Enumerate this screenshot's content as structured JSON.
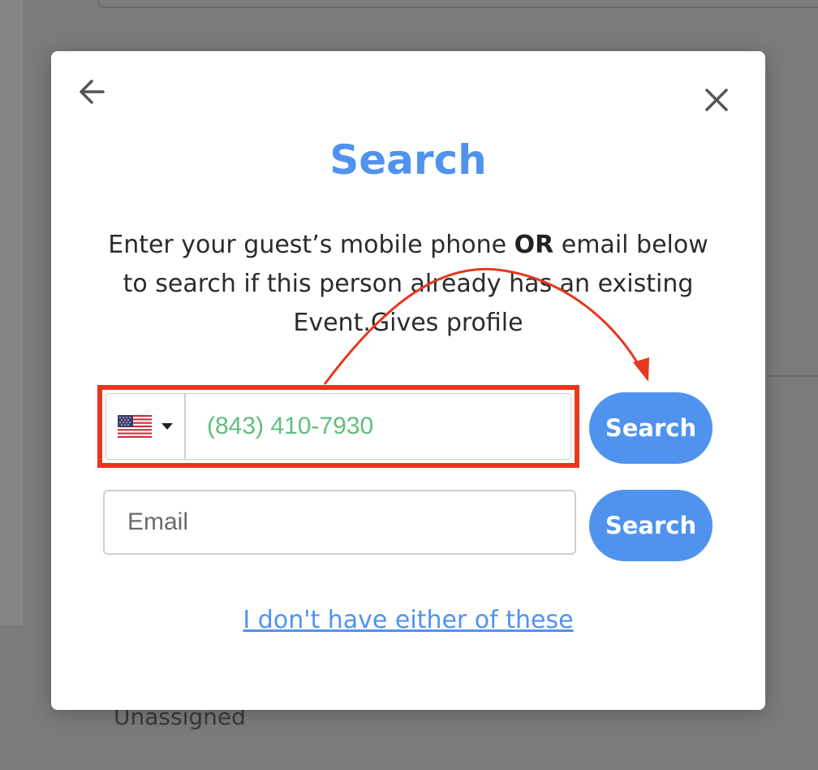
{
  "background": {
    "status_text": "Unassigned"
  },
  "modal": {
    "title": "Search",
    "instructions_part1": "Enter your guest’s mobile phone ",
    "instructions_bold": "OR",
    "instructions_part2": " email below to search if this person already has an existing Event.Gives profile",
    "phone": {
      "country_flag": "us-flag-icon",
      "value": "(843) 410-7930",
      "search_label": "Search"
    },
    "email": {
      "placeholder": "Email",
      "search_label": "Search"
    },
    "no_info_link": "I don't have either of these"
  },
  "colors": {
    "accent": "#4f93ee",
    "highlight": "#e5381f",
    "phone_text": "#5fbf7a"
  }
}
